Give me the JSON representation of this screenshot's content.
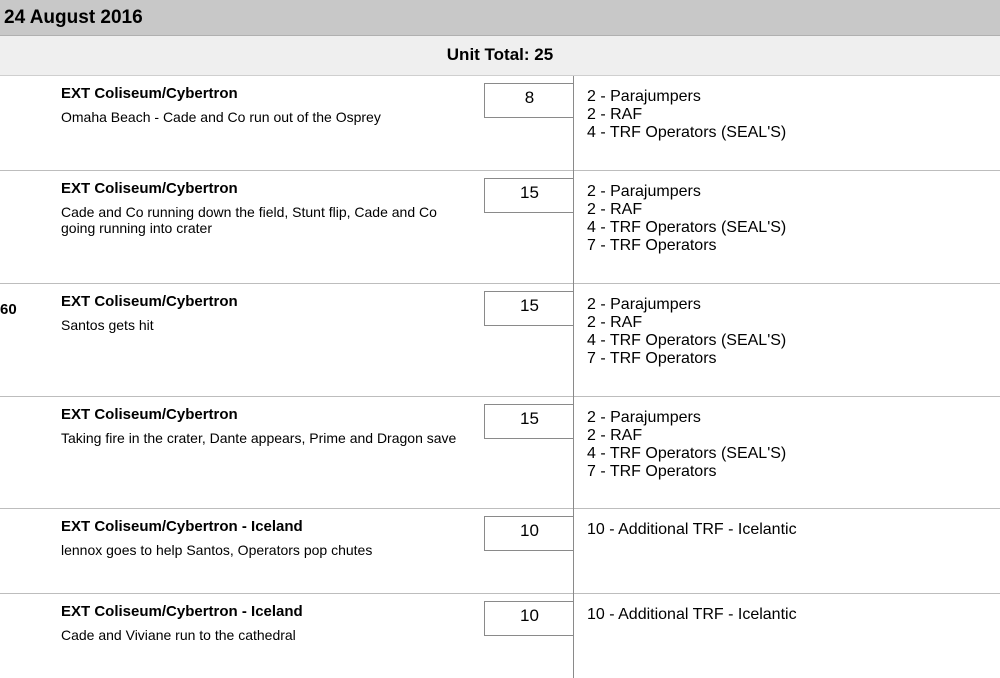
{
  "header": {
    "date": "24 August 2016",
    "unit_total": "Unit Total: 25"
  },
  "rows": [
    {
      "scene": "",
      "location": "EXT Coliseum/Cybertron",
      "description": "Omaha Beach - Cade and Co run out of the Osprey",
      "count": "8",
      "cast": [
        "2 - Parajumpers",
        "2 - RAF",
        "4 - TRF Operators (SEAL'S)"
      ]
    },
    {
      "scene": "",
      "location": "EXT Coliseum/Cybertron",
      "description": "Cade and Co running down the field, Stunt flip, Cade and Co going running into crater",
      "count": "15",
      "cast": [
        "2 - Parajumpers",
        "2 - RAF",
        "4 - TRF Operators (SEAL'S)",
        "7 - TRF Operators"
      ]
    },
    {
      "scene": "60",
      "location": "EXT Coliseum/Cybertron",
      "description": "Santos gets hit",
      "count": "15",
      "cast": [
        "2 - Parajumpers",
        "2 - RAF",
        "4 - TRF Operators (SEAL'S)",
        "7 - TRF Operators"
      ]
    },
    {
      "scene": "",
      "location": "EXT Coliseum/Cybertron",
      "description": "Taking fire in the crater, Dante appears, Prime and Dragon save",
      "count": "15",
      "cast": [
        "2 - Parajumpers",
        "2 - RAF",
        "4 - TRF Operators (SEAL'S)",
        "7 - TRF Operators"
      ]
    },
    {
      "scene": "",
      "location": "EXT Coliseum/Cybertron - Iceland",
      "description": "lennox goes to help Santos, Operators pop chutes",
      "count": "10",
      "cast": [
        "10 - Additional TRF - Icelantic"
      ]
    },
    {
      "scene": "",
      "location": "EXT Coliseum/Cybertron - Iceland",
      "description": "Cade and Viviane run to the cathedral",
      "count": "10",
      "cast": [
        "10 - Additional TRF - Icelantic"
      ]
    }
  ]
}
